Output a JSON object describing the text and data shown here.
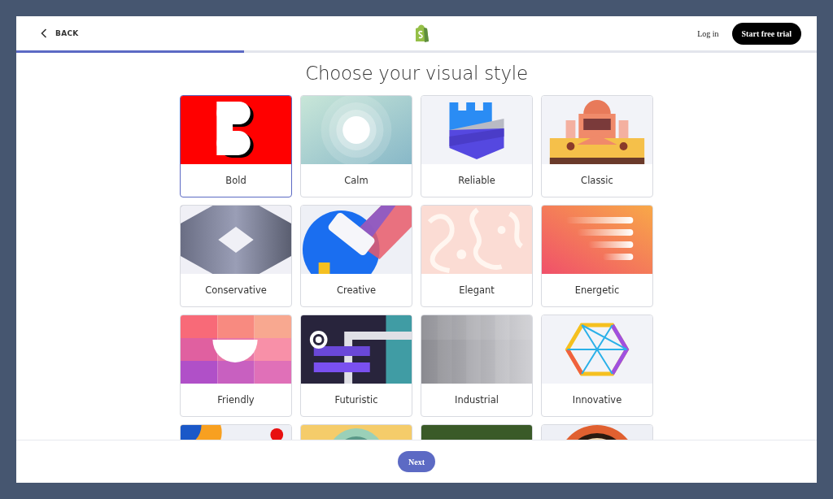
{
  "header": {
    "back": "BACK",
    "login": "Log in",
    "cta": "Start free trial"
  },
  "progress": {
    "level": 0.285
  },
  "title": "Choose your visual style",
  "styles": [
    {
      "label": "Bold",
      "selected": true
    },
    {
      "label": "Calm",
      "selected": false
    },
    {
      "label": "Reliable",
      "selected": false
    },
    {
      "label": "Classic",
      "selected": false
    },
    {
      "label": "Conservative",
      "selected": false
    },
    {
      "label": "Creative",
      "selected": false
    },
    {
      "label": "Elegant",
      "selected": false
    },
    {
      "label": "Energetic",
      "selected": false
    },
    {
      "label": "Friendly",
      "selected": false
    },
    {
      "label": "Futuristic",
      "selected": false
    },
    {
      "label": "Industrial",
      "selected": false
    },
    {
      "label": "Innovative",
      "selected": false
    },
    {
      "selected": false
    },
    {
      "selected": false
    },
    {
      "selected": false
    },
    {
      "selected": false
    }
  ],
  "next_button": "Next"
}
